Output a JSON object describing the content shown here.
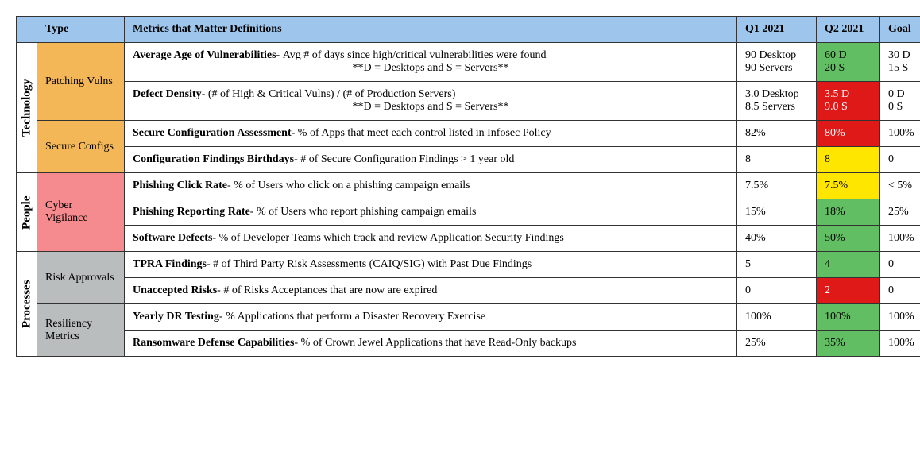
{
  "headers": {
    "type": "Type",
    "metrics": "Metrics that Matter Definitions",
    "q1": "Q1 2021",
    "q2": "Q2 2021",
    "goal": "Goal"
  },
  "categories": {
    "tech": "Technology",
    "people": "People",
    "processes": "Processes"
  },
  "types": {
    "patching": "Patching Vulns",
    "secure": "Secure Configs",
    "cyber": "Cyber Vigilance",
    "risk": "Risk Approvals",
    "resiliency": "Resiliency Metrics"
  },
  "rows": {
    "r1": {
      "title": "Average Age of Vulnerabilities- ",
      "desc": "Avg # of days since high/critical vulnerabilities were found",
      "note": "**D = Desktops  and S = Servers**",
      "q1": "90 Desktop\n90 Servers",
      "q2": "60 D\n20 S",
      "goal": "30 D\n15 S"
    },
    "r2": {
      "title": "Defect Density",
      "desc": "- (# of High & Critical Vulns) / (# of Production Servers)",
      "note": "**D = Desktops  and S = Servers**",
      "q1": "3.0 Desktop\n8.5 Servers",
      "q2": "3.5 D\n9.0 S",
      "goal": "0 D\n0 S"
    },
    "r3": {
      "title": "Secure Configuration Assessment",
      "desc": "- % of Apps that meet each control listed in Infosec Policy",
      "q1": "82%",
      "q2": "80%",
      "goal": "100%"
    },
    "r4": {
      "title": "Configuration Findings Birthdays",
      "desc": "- # of Secure Configuration Findings > 1 year old",
      "q1": "8",
      "q2": "8",
      "goal": "0"
    },
    "r5": {
      "title": "Phishing Click Rate",
      "desc": "- % of Users who click on a phishing campaign emails",
      "q1": "7.5%",
      "q2": "7.5%",
      "goal": "< 5%"
    },
    "r6": {
      "title": "Phishing Reporting Rate",
      "desc": "- % of Users who report phishing campaign emails",
      "q1": "15%",
      "q2": "18%",
      "goal": "25%"
    },
    "r7": {
      "title": "Software Defects",
      "desc": "- % of Developer Teams which track and review Application Security Findings",
      "q1": "40%",
      "q2": "50%",
      "goal": "100%"
    },
    "r8": {
      "title": "TPRA Findings",
      "desc": "- # of Third Party Risk Assessments (CAIQ/SIG) with Past Due Findings",
      "q1": "5",
      "q2": "4",
      "goal": "0"
    },
    "r9": {
      "title": "Unaccepted Risks",
      "desc": "- # of Risks Acceptances that are now are expired",
      "q1": "0",
      "q2": "2",
      "goal": "0"
    },
    "r10": {
      "title": "Yearly DR Testing",
      "desc": "- % Applications that perform a Disaster Recovery Exercise",
      "q1": "100%",
      "q2": "100%",
      "goal": "100%"
    },
    "r11": {
      "title": "Ransomware Defense Capabilities",
      "desc": "- % of Crown Jewel Applications that have Read-Only backups",
      "q1": "25%",
      "q2": "35%",
      "goal": "100%"
    }
  }
}
